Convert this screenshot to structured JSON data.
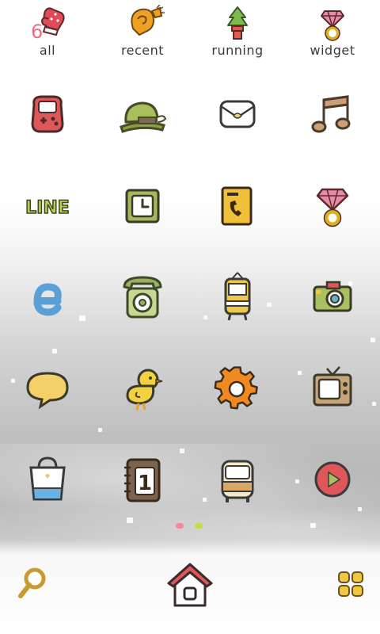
{
  "tabs": [
    {
      "label": "all",
      "icon": "mitten-icon"
    },
    {
      "label": "recent",
      "icon": "scarf-icon"
    },
    {
      "label": "running",
      "icon": "potted-tree-icon"
    },
    {
      "label": "widget",
      "icon": "gem-ring-icon"
    }
  ],
  "badge": {
    "value": "6"
  },
  "apps": [
    "gamepad-icon",
    "hat-icon",
    "mail-icon",
    "music-note-icon",
    "line-icon",
    "clock-icon",
    "phone-book-icon",
    "gem-ring-icon",
    "browser-e-icon",
    "telephone-icon",
    "tram-icon",
    "camera-icon",
    "speech-bubble-icon",
    "chick-icon",
    "settings-gear-icon",
    "tv-icon",
    "shopping-bag-icon",
    "calendar-icon",
    "bus-icon",
    "play-button-icon"
  ],
  "line_text": "LINE",
  "calendar_text": "1",
  "page_indicator": {
    "count": 2,
    "active": 0,
    "colors": [
      "#f08aa0",
      "#c8d94a"
    ]
  },
  "dock": [
    "search-icon",
    "home-icon",
    "app-drawer-icon"
  ]
}
